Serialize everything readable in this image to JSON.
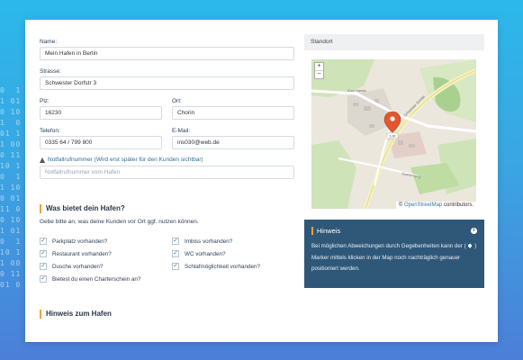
{
  "background_binary": "0  1\n1 01\n0 10\n1  0\n01 1\n1 00\n0 11\n10 1\n0  1\n1 10\n0 01\n11 0\n0 10\n1 01\n0  1\n10 1\n1 00\n0 11\n01 0",
  "form": {
    "name": {
      "label": "Name:",
      "value": "Mein Hafen in Berlin"
    },
    "strasse": {
      "label": "Strasse:",
      "value": "Schwester Dorfstr 3"
    },
    "plz": {
      "label": "Plz:",
      "value": "16230"
    },
    "ort": {
      "label": "Ort:",
      "value": "Chorin"
    },
    "telefon": {
      "label": "Telefon:",
      "value": "0335 64 / 799 800"
    },
    "email": {
      "label": "E-Mail:",
      "value": "ins030@web.de"
    },
    "notfall": {
      "label": "Notfallrufnummer (Wird erst später für den Kunden sichtbar)",
      "placeholder": "Notfallrufnummer vom Hafen"
    }
  },
  "offers": {
    "title": "Was bietet dein Hafen?",
    "subtitle": "Gebe bitte an, was deine Kunden vor Ort ggf. nutzen können.",
    "left": [
      {
        "label": "Parkplatz vorhanden?",
        "checked": true
      },
      {
        "label": "Restaurant vorhanden?",
        "checked": true
      },
      {
        "label": "Dusche vorhanden?",
        "checked": true
      },
      {
        "label": "Bietest du einen Charterschein an?",
        "checked": true
      }
    ],
    "right": [
      {
        "label": "Imbiss vorhanden?",
        "checked": true
      },
      {
        "label": "WC vorhanden?",
        "checked": true
      },
      {
        "label": "Schlafmöglichkeit vorhanden?",
        "checked": true
      }
    ]
  },
  "hinweis_hafen": {
    "title": "Hinweis zum Hafen"
  },
  "standort": {
    "title": "Standort",
    "map_label": "1,00",
    "road_label_1": "Zum Sande",
    "road_label_2": "Schwester Dorfstr",
    "road_label_3": "Sonnenweg",
    "attribution_prefix": "©",
    "attribution_link": "OpenStreetMap",
    "attribution_suffix": "contributors."
  },
  "hinweis_box": {
    "title": "Hinweis",
    "text_before": "Bei möglichen Abweichungen durch Gegebenheiten kann der (",
    "text_after": ") Marker mittels klicken in der Map noch nachträglich genauer positioniert werden."
  },
  "colors": {
    "accent": "#f0a23a",
    "panel": "#2f5878",
    "link": "#3a7bb0"
  }
}
